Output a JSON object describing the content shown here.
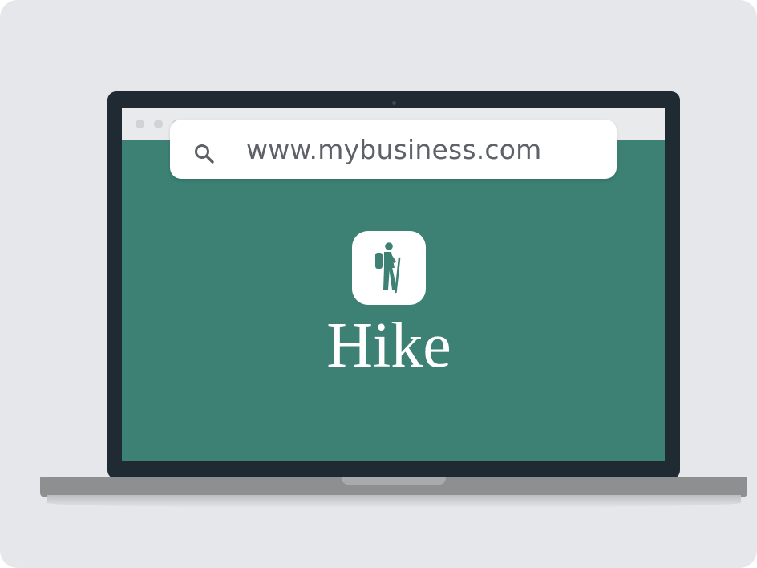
{
  "browser": {
    "address_bar": {
      "url": "www.mybusiness.com",
      "icon": "search-icon"
    }
  },
  "site": {
    "logo_icon": "hiker-icon",
    "brand_name": "Hike"
  },
  "colors": {
    "background": "#e6e7eb",
    "screen_green": "#3c8174",
    "laptop_bezel": "#1f2a33",
    "laptop_base": "#8e8f91",
    "url_text": "#5e6168",
    "white": "#ffffff"
  }
}
